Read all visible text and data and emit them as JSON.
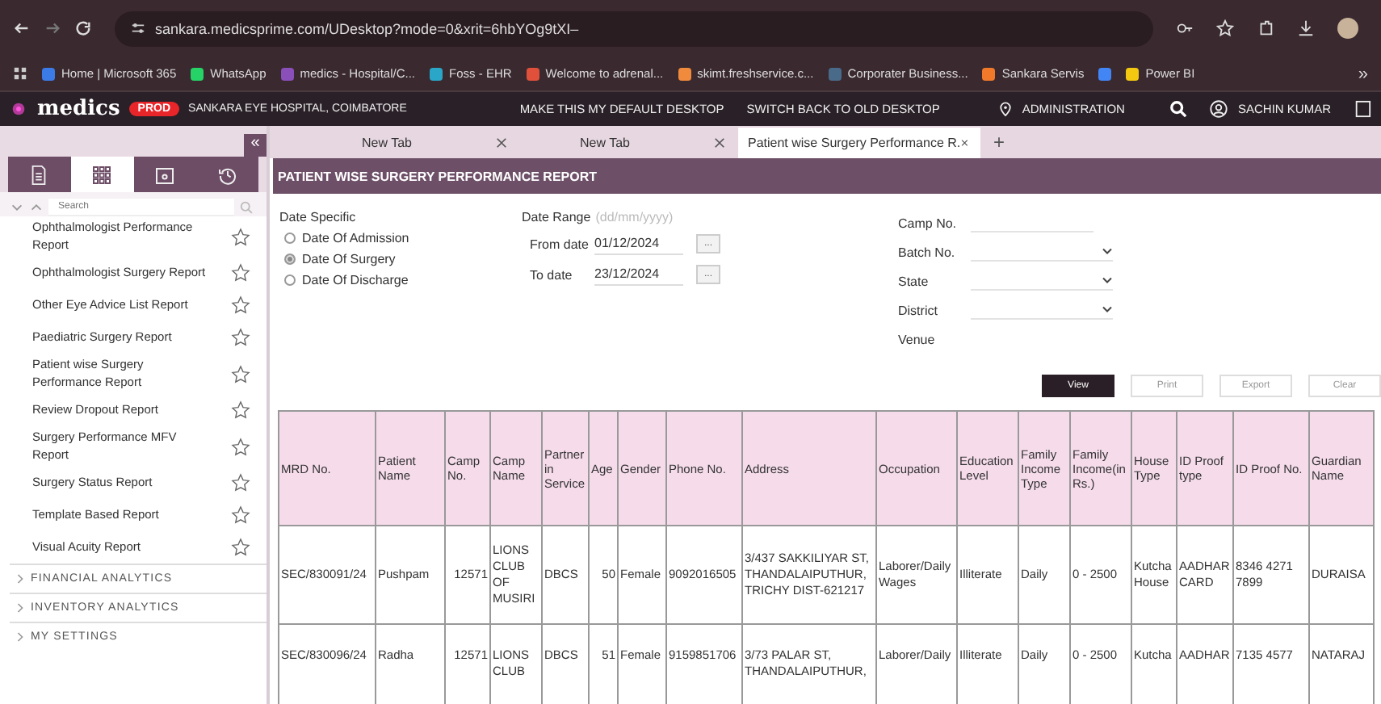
{
  "browser": {
    "url": "sankara.medicsprime.com/UDesktop?mode=0&xrit=6hbYOg9tXI–",
    "bookmarks": [
      {
        "label": "Home | Microsoft 365",
        "color": "#3b7be8"
      },
      {
        "label": "WhatsApp",
        "color": "#25d366"
      },
      {
        "label": "medics - Hospital/C...",
        "color": "#8a4fb8"
      },
      {
        "label": "Foss - EHR",
        "color": "#2aa6c8"
      },
      {
        "label": "Welcome to adrenal...",
        "color": "#e0503a"
      },
      {
        "label": "skimt.freshservice.c...",
        "color": "#f08a3c"
      },
      {
        "label": "Corporater Business...",
        "color": "#4a6a8a"
      },
      {
        "label": "Sankara Servis",
        "color": "#f07a2a"
      },
      {
        "color": "#4285f4"
      },
      {
        "label": "Power BI",
        "color": "#f2c811"
      }
    ],
    "overflow": "»"
  },
  "header": {
    "logo": "medics",
    "env": "PROD",
    "hospital": "SANKARA EYE HOSPITAL, COIMBATORE",
    "links": [
      "MAKE THIS MY DEFAULT DESKTOP",
      "SWITCH BACK TO OLD DESKTOP"
    ],
    "location": "ADMINISTRATION",
    "user": "SACHIN KUMAR"
  },
  "tabs": [
    {
      "label": "New Tab",
      "selected": false
    },
    {
      "label": "New Tab",
      "selected": false
    },
    {
      "label": "Patient wise Surgery Performance R.",
      "selected": true
    }
  ],
  "new_tab": "+",
  "sidebar": {
    "collapse": "«",
    "tabs": [
      {
        "kind": "document",
        "selected": false
      },
      {
        "kind": "grid",
        "selected": true
      },
      {
        "kind": "folder",
        "selected": false
      },
      {
        "kind": "history",
        "selected": false
      }
    ],
    "search_placeholder": "Search",
    "items": [
      {
        "label": "Ophthalmologist Performance Report",
        "starred": false
      },
      {
        "label": "Ophthalmologist Surgery Report",
        "starred": false
      },
      {
        "label": "Other Eye Advice List Report",
        "starred": false
      },
      {
        "label": "Paediatric Surgery Report",
        "starred": false
      },
      {
        "label": "Patient wise Surgery Performance Report",
        "starred": false
      },
      {
        "label": "Review Dropout Report",
        "starred": false
      },
      {
        "label": "Surgery Performance MFV Report",
        "starred": false
      },
      {
        "label": "Surgery Status Report",
        "starred": false
      },
      {
        "label": "Template Based Report",
        "starred": false
      },
      {
        "label": "Visual Acuity Report",
        "starred": false
      }
    ],
    "sections": [
      "FINANCIAL ANALYTICS",
      "INVENTORY ANALYTICS",
      "MY SETTINGS"
    ]
  },
  "report": {
    "title": "PATIENT WISE SURGERY PERFORMANCE REPORT",
    "date_specific": {
      "label": "Date Specific",
      "options": [
        {
          "label": "Date Of Admission",
          "selected": false
        },
        {
          "label": "Date Of Surgery",
          "selected": true
        },
        {
          "label": "Date Of Discharge",
          "selected": false
        }
      ]
    },
    "date_range": {
      "label": "Date Range",
      "hint": "(dd/mm/yyyy)",
      "fields": [
        {
          "label": "From date",
          "value": "01/12/2024",
          "button": "..."
        },
        {
          "label": "To date",
          "value": "23/12/2024",
          "button": "..."
        }
      ]
    },
    "filters": [
      {
        "label": "Camp No.",
        "kind": "text"
      },
      {
        "label": "Batch No.",
        "kind": "select"
      },
      {
        "label": "State",
        "kind": "select"
      },
      {
        "label": "District",
        "kind": "select"
      },
      {
        "label": "Venue",
        "kind": "label"
      }
    ],
    "buttons": [
      {
        "label": "View",
        "primary": true
      },
      {
        "label": "Print",
        "primary": false
      },
      {
        "label": "Export",
        "primary": false
      },
      {
        "label": "Clear",
        "primary": false
      }
    ]
  },
  "table": {
    "columns": [
      "MRD No.",
      "Patient Name",
      "Camp No.",
      "Camp Name",
      "Partner in Service",
      "Age",
      "Gender",
      "Phone No.",
      "Address",
      "Occupation",
      "Education Level",
      "Family Income Type",
      "Family Income(in Rs.)",
      "House Type",
      "ID Proof type",
      "ID Proof No.",
      "Guardian Name"
    ],
    "rows": [
      [
        "SEC/830091/24",
        "Pushpam",
        "12571",
        "LIONS CLUB OF MUSIRI",
        "DBCS",
        "50",
        "Female",
        "9092016505",
        "3/437 SAKKILIYAR ST, THANDALAIPUTHUR, TRICHY DIST-621217",
        "Laborer/Daily Wages",
        "Illiterate",
        "Daily",
        "0 - 2500",
        "Kutcha House",
        "AADHAR CARD",
        "8346 4271 7899",
        "DURAISA"
      ],
      [
        "SEC/830096/24",
        "Radha",
        "12571",
        "LIONS CLUB",
        "DBCS",
        "51",
        "Female",
        "9159851706",
        "3/73 PALAR ST, THANDALAIPUTHUR,",
        "Laborer/Daily",
        "Illiterate",
        "Daily",
        "0 - 2500",
        "Kutcha",
        "AADHAR",
        "7135 4577",
        "NATARAJ"
      ]
    ]
  }
}
